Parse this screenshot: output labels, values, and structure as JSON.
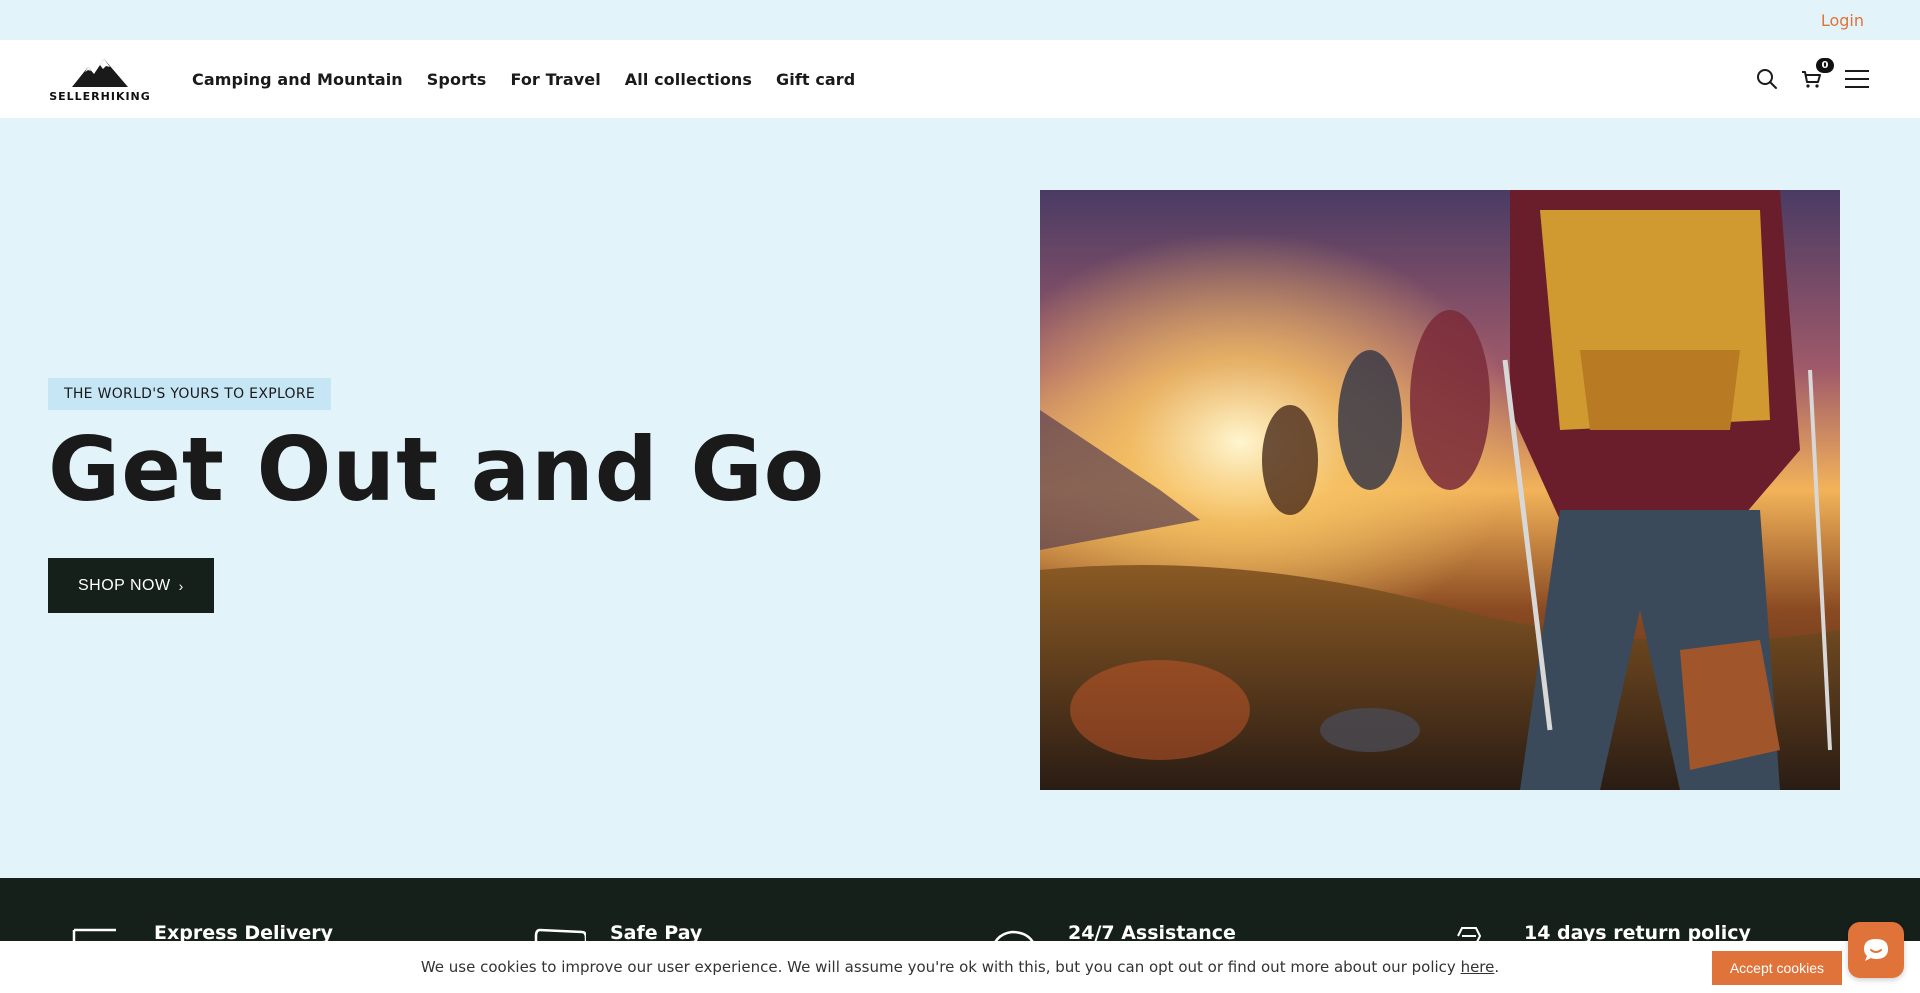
{
  "topbar": {
    "login_label": "Login"
  },
  "header": {
    "logo_text": "SELLERHIKING",
    "nav": [
      {
        "label": "Camping and Mountain"
      },
      {
        "label": "Sports"
      },
      {
        "label": "For Travel"
      },
      {
        "label": "All collections"
      },
      {
        "label": "Gift card"
      }
    ],
    "icons": [
      "search-icon",
      "cart-icon",
      "menu-icon"
    ],
    "cart_count": "0"
  },
  "hero": {
    "eyebrow": "THE WORLD'S YOURS TO EXPLORE",
    "title": "Get Out and Go",
    "cta_label": "SHOP NOW",
    "cta_icon": "chevron-right-icon"
  },
  "features": [
    {
      "title": "Express Delivery",
      "icon": "truck-icon"
    },
    {
      "title": "Safe Pay",
      "icon": "card-icon"
    },
    {
      "title": "24/7 Assistance",
      "icon": "refresh-icon"
    },
    {
      "title": "14 days return policy",
      "icon": "badge-icon"
    }
  ],
  "cookie": {
    "text": "We use cookies to improve our user experience. We will assume you're ok with this, but you can opt out or find out more about our policy ",
    "link_label": "here",
    "suffix": ".",
    "accept_label": "Accept cookies"
  },
  "colors": {
    "accent": "#e0733a",
    "background": "#e3f3fa",
    "dark": "#16201a"
  }
}
